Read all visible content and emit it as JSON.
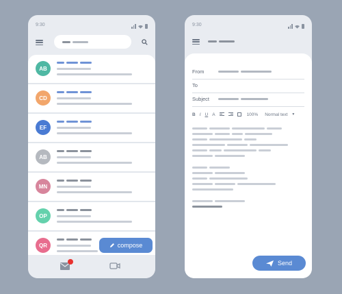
{
  "inbox_screen": {
    "status_time": "9:30",
    "contacts": [
      {
        "initials": "AB",
        "color": "#4fb8a3",
        "unread": true
      },
      {
        "initials": "CD",
        "color": "#f2a66b",
        "unread": true
      },
      {
        "initials": "EF",
        "color": "#4a7bd3",
        "unread": true
      },
      {
        "initials": "AB",
        "color": "#b5b9bf",
        "unread": false
      },
      {
        "initials": "MN",
        "color": "#d7859c",
        "unread": false
      },
      {
        "initials": "OP",
        "color": "#64d1ac",
        "unread": false
      },
      {
        "initials": "QR",
        "color": "#e86d8e",
        "unread": false
      }
    ],
    "compose_label": "compose",
    "icons": {
      "menu": "hamburger-icon",
      "search": "search-icon",
      "compose": "pencil-icon",
      "mail": "mail-icon",
      "video": "video-icon"
    },
    "notification_color": "#e8322f"
  },
  "compose_screen": {
    "status_time": "9:30",
    "from_label": "From",
    "to_label": "To",
    "subject_label": "Subject",
    "toolbar": {
      "bold": "B",
      "italic": "I",
      "underline": "U",
      "font_size": "A",
      "zoom": "100%",
      "text_style": "Normal text"
    },
    "send_label": "Send",
    "icons": {
      "menu": "hamburger-icon",
      "send": "paper-plane-icon"
    }
  },
  "colors": {
    "background": "#9aa5b4",
    "accent": "#5a8ad3",
    "unread_bar": "#6f93d6"
  }
}
